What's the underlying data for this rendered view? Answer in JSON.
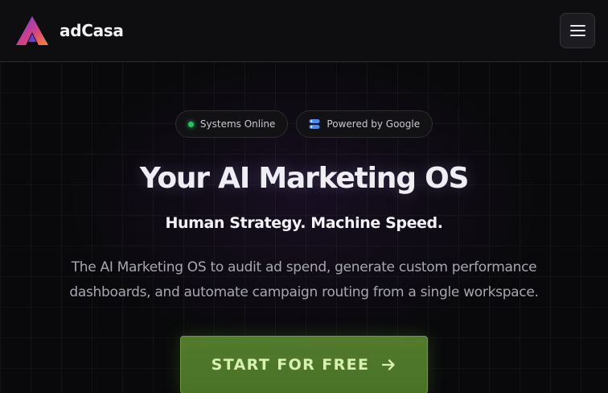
{
  "header": {
    "brand_name": "adCasa",
    "logo_icon": "adcasa-logo-icon",
    "menu_icon": "hamburger-menu-icon"
  },
  "badges": [
    {
      "label": "Systems Online",
      "icon": "status-dot-icon",
      "color": "#22c55e"
    },
    {
      "label": "Powered by Google",
      "icon": "google-cloud-icon",
      "color": "#4a8cf7"
    }
  ],
  "hero": {
    "title": "Your AI Marketing OS",
    "subtitle": "Human Strategy. Machine Speed.",
    "description": "The AI Marketing OS to audit ad spend, generate custom performance dashboards, and automate campaign routing from a single workspace.",
    "cta_label": "START FOR FREE",
    "cta_icon": "arrow-right-icon"
  },
  "colors": {
    "accent_green": "#4f7a2a",
    "logo_gradient": [
      "#6b3fd6",
      "#d23f8a",
      "#f08a2c"
    ]
  }
}
